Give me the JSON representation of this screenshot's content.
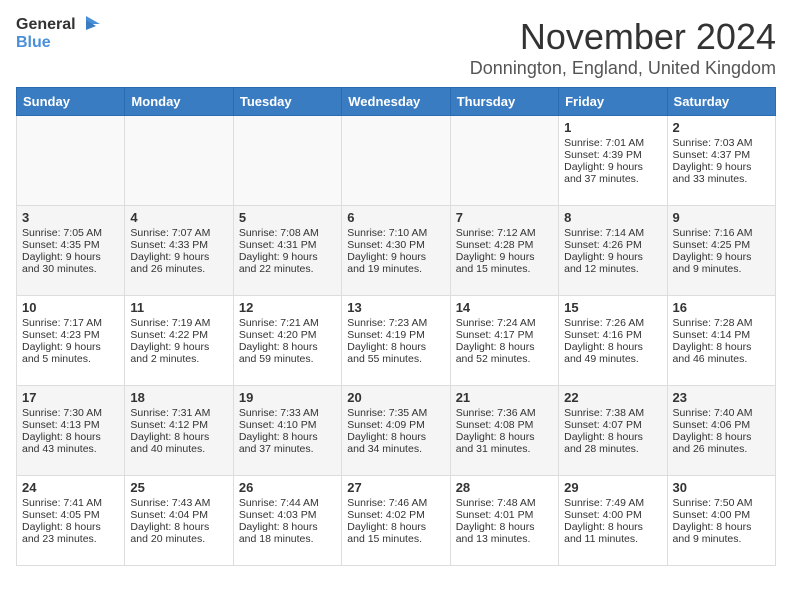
{
  "logo": {
    "general": "General",
    "blue": "Blue"
  },
  "title": "November 2024",
  "location": "Donnington, England, United Kingdom",
  "days_of_week": [
    "Sunday",
    "Monday",
    "Tuesday",
    "Wednesday",
    "Thursday",
    "Friday",
    "Saturday"
  ],
  "weeks": [
    [
      {
        "day": "",
        "info": ""
      },
      {
        "day": "",
        "info": ""
      },
      {
        "day": "",
        "info": ""
      },
      {
        "day": "",
        "info": ""
      },
      {
        "day": "",
        "info": ""
      },
      {
        "day": "1",
        "info": "Sunrise: 7:01 AM\nSunset: 4:39 PM\nDaylight: 9 hours and 37 minutes."
      },
      {
        "day": "2",
        "info": "Sunrise: 7:03 AM\nSunset: 4:37 PM\nDaylight: 9 hours and 33 minutes."
      }
    ],
    [
      {
        "day": "3",
        "info": "Sunrise: 7:05 AM\nSunset: 4:35 PM\nDaylight: 9 hours and 30 minutes."
      },
      {
        "day": "4",
        "info": "Sunrise: 7:07 AM\nSunset: 4:33 PM\nDaylight: 9 hours and 26 minutes."
      },
      {
        "day": "5",
        "info": "Sunrise: 7:08 AM\nSunset: 4:31 PM\nDaylight: 9 hours and 22 minutes."
      },
      {
        "day": "6",
        "info": "Sunrise: 7:10 AM\nSunset: 4:30 PM\nDaylight: 9 hours and 19 minutes."
      },
      {
        "day": "7",
        "info": "Sunrise: 7:12 AM\nSunset: 4:28 PM\nDaylight: 9 hours and 15 minutes."
      },
      {
        "day": "8",
        "info": "Sunrise: 7:14 AM\nSunset: 4:26 PM\nDaylight: 9 hours and 12 minutes."
      },
      {
        "day": "9",
        "info": "Sunrise: 7:16 AM\nSunset: 4:25 PM\nDaylight: 9 hours and 9 minutes."
      }
    ],
    [
      {
        "day": "10",
        "info": "Sunrise: 7:17 AM\nSunset: 4:23 PM\nDaylight: 9 hours and 5 minutes."
      },
      {
        "day": "11",
        "info": "Sunrise: 7:19 AM\nSunset: 4:22 PM\nDaylight: 9 hours and 2 minutes."
      },
      {
        "day": "12",
        "info": "Sunrise: 7:21 AM\nSunset: 4:20 PM\nDaylight: 8 hours and 59 minutes."
      },
      {
        "day": "13",
        "info": "Sunrise: 7:23 AM\nSunset: 4:19 PM\nDaylight: 8 hours and 55 minutes."
      },
      {
        "day": "14",
        "info": "Sunrise: 7:24 AM\nSunset: 4:17 PM\nDaylight: 8 hours and 52 minutes."
      },
      {
        "day": "15",
        "info": "Sunrise: 7:26 AM\nSunset: 4:16 PM\nDaylight: 8 hours and 49 minutes."
      },
      {
        "day": "16",
        "info": "Sunrise: 7:28 AM\nSunset: 4:14 PM\nDaylight: 8 hours and 46 minutes."
      }
    ],
    [
      {
        "day": "17",
        "info": "Sunrise: 7:30 AM\nSunset: 4:13 PM\nDaylight: 8 hours and 43 minutes."
      },
      {
        "day": "18",
        "info": "Sunrise: 7:31 AM\nSunset: 4:12 PM\nDaylight: 8 hours and 40 minutes."
      },
      {
        "day": "19",
        "info": "Sunrise: 7:33 AM\nSunset: 4:10 PM\nDaylight: 8 hours and 37 minutes."
      },
      {
        "day": "20",
        "info": "Sunrise: 7:35 AM\nSunset: 4:09 PM\nDaylight: 8 hours and 34 minutes."
      },
      {
        "day": "21",
        "info": "Sunrise: 7:36 AM\nSunset: 4:08 PM\nDaylight: 8 hours and 31 minutes."
      },
      {
        "day": "22",
        "info": "Sunrise: 7:38 AM\nSunset: 4:07 PM\nDaylight: 8 hours and 28 minutes."
      },
      {
        "day": "23",
        "info": "Sunrise: 7:40 AM\nSunset: 4:06 PM\nDaylight: 8 hours and 26 minutes."
      }
    ],
    [
      {
        "day": "24",
        "info": "Sunrise: 7:41 AM\nSunset: 4:05 PM\nDaylight: 8 hours and 23 minutes."
      },
      {
        "day": "25",
        "info": "Sunrise: 7:43 AM\nSunset: 4:04 PM\nDaylight: 8 hours and 20 minutes."
      },
      {
        "day": "26",
        "info": "Sunrise: 7:44 AM\nSunset: 4:03 PM\nDaylight: 8 hours and 18 minutes."
      },
      {
        "day": "27",
        "info": "Sunrise: 7:46 AM\nSunset: 4:02 PM\nDaylight: 8 hours and 15 minutes."
      },
      {
        "day": "28",
        "info": "Sunrise: 7:48 AM\nSunset: 4:01 PM\nDaylight: 8 hours and 13 minutes."
      },
      {
        "day": "29",
        "info": "Sunrise: 7:49 AM\nSunset: 4:00 PM\nDaylight: 8 hours and 11 minutes."
      },
      {
        "day": "30",
        "info": "Sunrise: 7:50 AM\nSunset: 4:00 PM\nDaylight: 8 hours and 9 minutes."
      }
    ]
  ]
}
